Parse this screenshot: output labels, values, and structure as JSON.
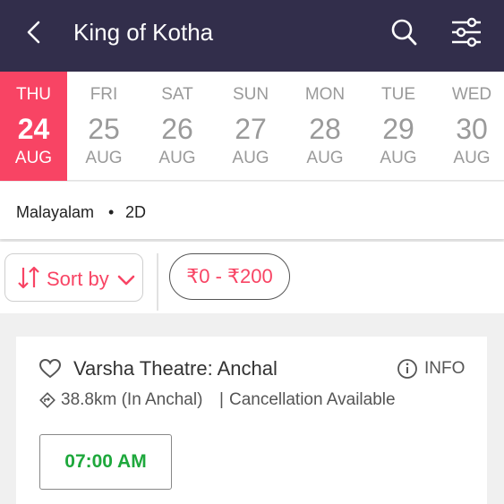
{
  "header": {
    "title": "King of Kotha",
    "back_icon": "chevron-left-icon",
    "search_icon": "search-icon",
    "filter_icon": "sliders-icon",
    "background": "#322e4b"
  },
  "dates": [
    {
      "dow": "THU",
      "day": "24",
      "month": "AUG",
      "selected": true
    },
    {
      "dow": "FRI",
      "day": "25",
      "month": "AUG",
      "selected": false
    },
    {
      "dow": "SAT",
      "day": "26",
      "month": "AUG",
      "selected": false
    },
    {
      "dow": "SUN",
      "day": "27",
      "month": "AUG",
      "selected": false
    },
    {
      "dow": "MON",
      "day": "28",
      "month": "AUG",
      "selected": false
    },
    {
      "dow": "TUE",
      "day": "29",
      "month": "AUG",
      "selected": false
    },
    {
      "dow": "WED",
      "day": "30",
      "month": "AUG",
      "selected": false
    }
  ],
  "accent_color": "#f84464",
  "language_bar": {
    "language": "Malayalam",
    "separator": "•",
    "format": "2D"
  },
  "filters": {
    "sort_label": "Sort by",
    "price_range": "₹0 - ₹200"
  },
  "theatre": {
    "name": "Varsha Theatre: Anchal",
    "info_label": "INFO",
    "distance": "38.8km (In Anchal)",
    "separator": "|",
    "cancellation": "Cancellation Available",
    "showtime": "07:00 AM",
    "showtime_color": "#1ea83c"
  }
}
